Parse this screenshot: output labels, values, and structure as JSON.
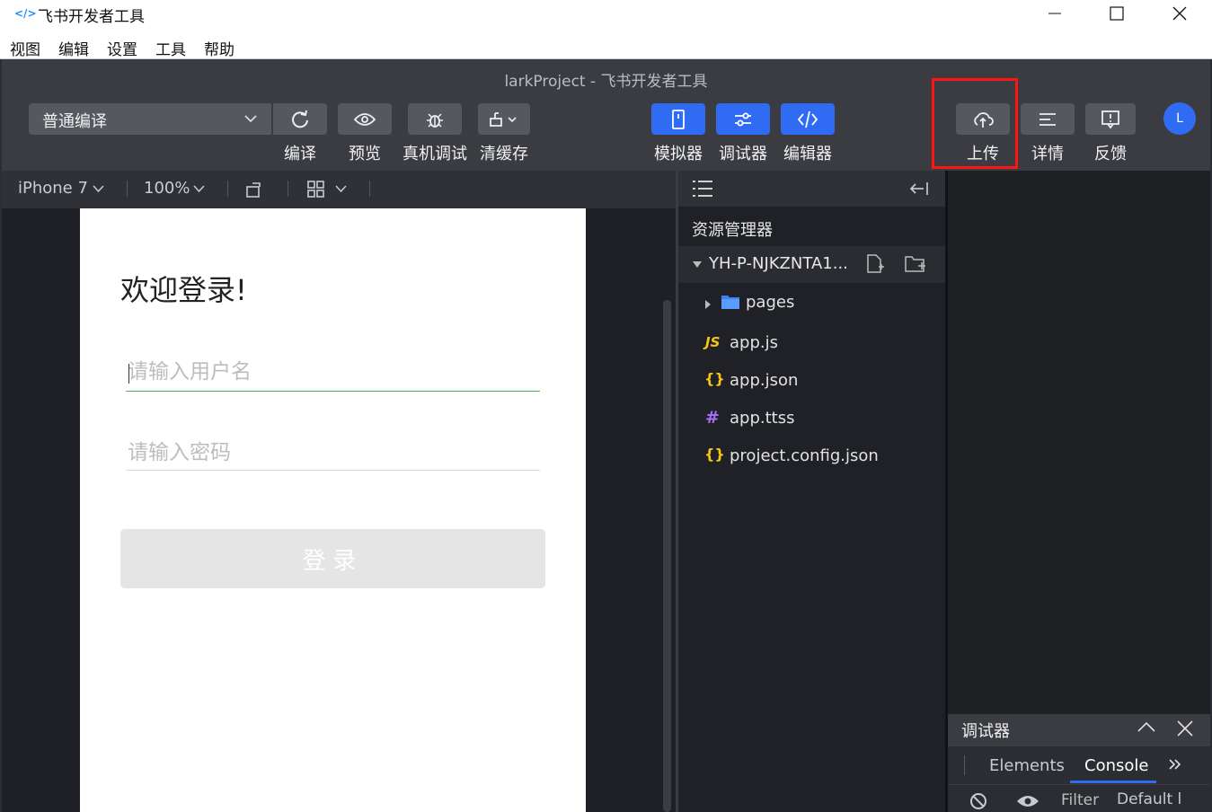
{
  "window": {
    "title": "飞书开发者工具",
    "logo": "</>"
  },
  "menubar": {
    "items": [
      {
        "label": "视图"
      },
      {
        "label": "编辑"
      },
      {
        "label": "设置"
      },
      {
        "label": "工具"
      },
      {
        "label": "帮助"
      }
    ]
  },
  "project_title": "larkProject - 飞书开发者工具",
  "toolbar": {
    "compile_mode": "普通编译",
    "compile_label": "编译",
    "preview_label": "预览",
    "remote_debug_label": "真机调试",
    "clear_cache_label": "清缓存",
    "simulator_label": "模拟器",
    "debugger_label": "调试器",
    "editor_label": "编辑器",
    "upload_label": "上传",
    "details_label": "详情",
    "feedback_label": "反馈",
    "avatar_initial": "L"
  },
  "simulator": {
    "device": "iPhone 7",
    "zoom": "100%",
    "page": {
      "welcome": "欢迎登录!",
      "username_placeholder": "请输入用户名",
      "password_placeholder": "请输入密码",
      "login_button": "登录"
    }
  },
  "explorer": {
    "title": "资源管理器",
    "project": "YH-P-NJKZNTA1...",
    "files": [
      {
        "name": "pages",
        "icon": "folder-icon",
        "icon_text": ""
      },
      {
        "name": "app.js",
        "icon": "js-file-icon",
        "icon_text": "JS"
      },
      {
        "name": "app.json",
        "icon": "json-file-icon",
        "icon_text": "{}"
      },
      {
        "name": "app.ttss",
        "icon": "ttss-file-icon",
        "icon_text": "#"
      },
      {
        "name": "project.config.json",
        "icon": "json-file-icon",
        "icon_text": "{}"
      }
    ]
  },
  "debugger": {
    "title": "调试器",
    "tabs": [
      "Elements",
      "Console"
    ],
    "active_tab": "Console",
    "filter_placeholder": "Filter",
    "level": "Default l"
  },
  "colors": {
    "accent": "#2f6bf3",
    "highlight": "#ff1414",
    "input_focus": "#4caf50"
  }
}
